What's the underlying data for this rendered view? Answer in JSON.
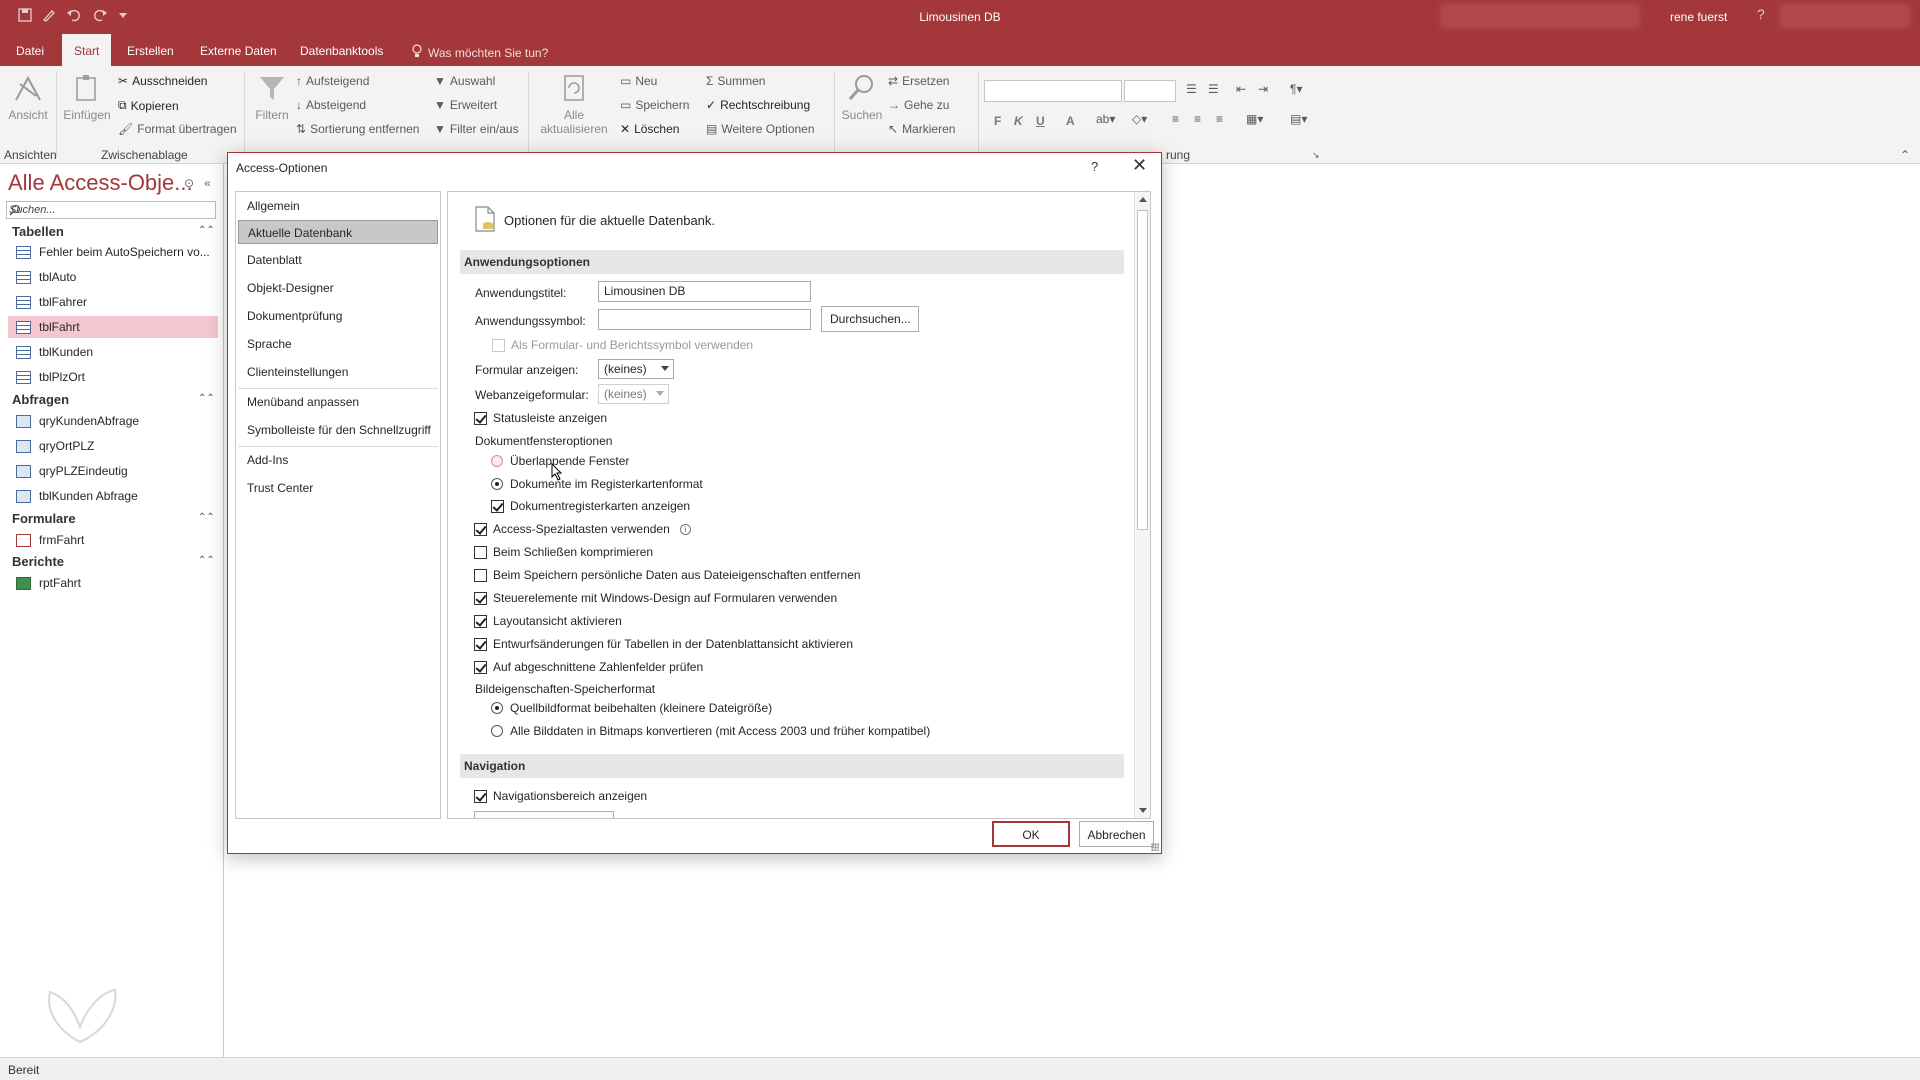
{
  "app": {
    "title": "Limousinen DB",
    "user": "rene fuerst",
    "help_glyph": "?"
  },
  "ribbon_tabs": [
    "Datei",
    "Start",
    "Erstellen",
    "Externe Daten",
    "Datenbanktools"
  ],
  "tell_me": "Was möchten Sie tun?",
  "ribbon": {
    "ansicht": "Ansicht",
    "einfuegen": "Einfügen",
    "ausschneiden": "Ausschneiden",
    "kopieren": "Kopieren",
    "format_uebertragen": "Format übertragen",
    "filtern": "Filtern",
    "aufsteigend": "Aufsteigend",
    "absteigend": "Absteigend",
    "sortierung_entfernen": "Sortierung entfernen",
    "auswahl": "Auswahl",
    "erweitert": "Erweitert",
    "filter_ein_aus": "Filter ein/aus",
    "alle_aktualisieren_1": "Alle",
    "alle_aktualisieren_2": "aktualisieren",
    "neu": "Neu",
    "speichern": "Speichern",
    "loeschen": "Löschen",
    "summen": "Summen",
    "rechtschreibung": "Rechtschreibung",
    "weitere_optionen": "Weitere Optionen",
    "suchen": "Suchen",
    "ersetzen": "Ersetzen",
    "gehe_zu": "Gehe zu",
    "markieren": "Markieren",
    "bold": "F",
    "italic": "K",
    "underline": "U",
    "font_color": "A",
    "group_ansichten": "Ansichten",
    "group_zwischenablage": "Zwischenablage",
    "group_formatierung_partial": "rung"
  },
  "nav": {
    "title": "Alle Access-Obje...",
    "search_placeholder": "Suchen...",
    "groups": [
      {
        "label": "Tabellen",
        "items": [
          "Fehler beim AutoSpeichern vo...",
          "tblAuto",
          "tblFahrer",
          "tblFahrt",
          "tblKunden",
          "tblPlzOrt"
        ]
      },
      {
        "label": "Abfragen",
        "items": [
          "qryKundenAbfrage",
          "qryOrtPLZ",
          "qryPLZEindeutig",
          "tblKunden Abfrage"
        ]
      },
      {
        "label": "Formulare",
        "items": [
          "frmFahrt"
        ]
      },
      {
        "label": "Berichte",
        "items": [
          "rptFahrt"
        ]
      }
    ]
  },
  "status": "Bereit",
  "dialog": {
    "title": "Access-Optionen",
    "help": "?",
    "close": "✕",
    "categories": [
      "Allgemein",
      "Aktuelle Datenbank",
      "Datenblatt",
      "Objekt-Designer",
      "Dokumentprüfung",
      "Sprache",
      "Clienteinstellungen",
      "Menüband anpassen",
      "Symbolleiste für den Schnellzugriff",
      "Add-Ins",
      "Trust Center"
    ],
    "heading": "Optionen für die aktuelle Datenbank.",
    "section_app": "Anwendungsoptionen",
    "label_app_title": "Anwendungstitel:",
    "value_app_title": "Limousinen DB",
    "label_app_icon": "Anwendungssymbol:",
    "value_app_icon": "",
    "browse": "Durchsuchen...",
    "use_as_form_icon": "Als Formular- und Berichtssymbol verwenden",
    "label_show_form": "Formular anzeigen:",
    "value_show_form": "(keines)",
    "label_web_form": "Webanzeigeformular:",
    "value_web_form": "(keines)",
    "show_statusbar": "Statusleiste anzeigen",
    "doc_window_options": "Dokumentfensteroptionen",
    "overlapping_windows": "Überlappende Fenster",
    "tabbed_documents": "Dokumente im Registerkartenformat",
    "show_doc_tabs": "Dokumentregisterkarten anzeigen",
    "access_keys": "Access-Spezialtasten verwenden",
    "compact_on_close": "Beim Schließen komprimieren",
    "remove_personal": "Beim Speichern persönliche Daten aus Dateieigenschaften entfernen",
    "windows_themed": "Steuerelemente mit Windows-Design auf Formularen verwenden",
    "layout_view": "Layoutansicht aktivieren",
    "design_changes": "Entwurfsänderungen für Tabellen in der Datenblattansicht aktivieren",
    "truncated_numbers": "Auf abgeschnittene Zahlenfelder prüfen",
    "picture_format": "Bildeigenschaften-Speicherformat",
    "keep_source": "Quellbildformat beibehalten (kleinere Dateigröße)",
    "convert_bitmaps": "Alle Bilddaten in Bitmaps konvertieren (mit Access 2003 und früher kompatibel)",
    "section_nav": "Navigation",
    "show_nav_pane": "Navigationsbereich anzeigen",
    "ok": "OK",
    "cancel": "Abbrechen"
  }
}
